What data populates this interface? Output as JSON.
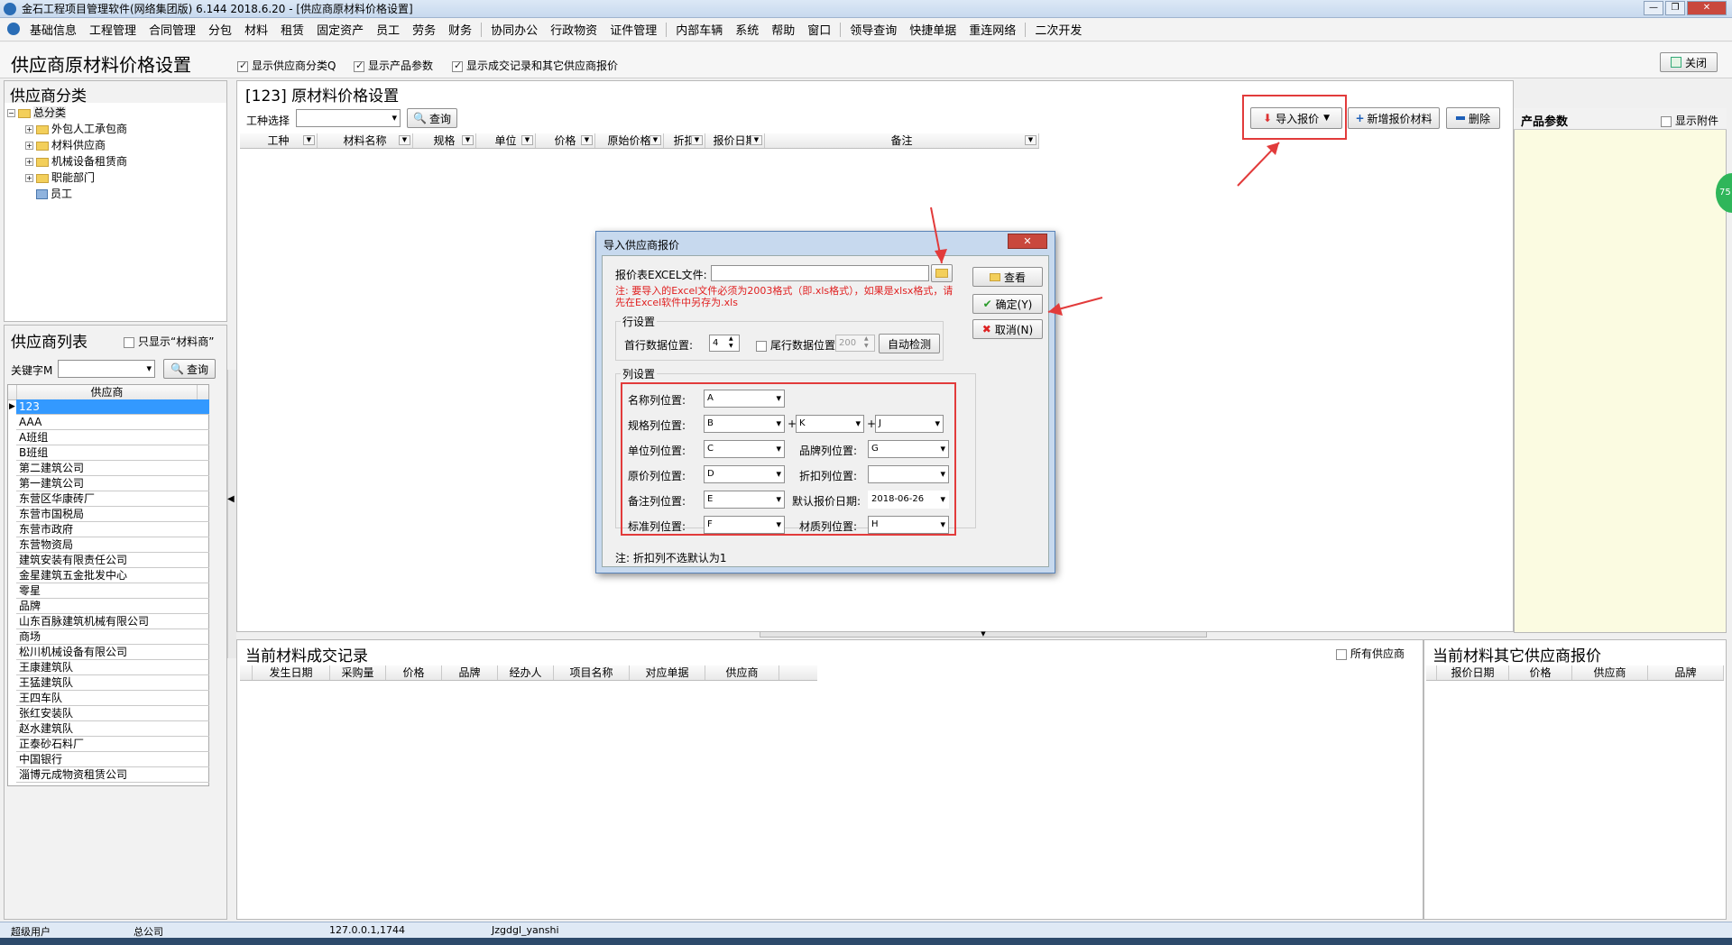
{
  "window": {
    "title": "金石工程项目管理软件(网络集团版) 6.144  2018.6.20 - [供应商原材料价格设置]"
  },
  "menu": [
    "基础信息",
    "工程管理",
    "合同管理",
    "分包",
    "材料",
    "租赁",
    "固定资产",
    "员工",
    "劳务",
    "财务",
    "协同办公",
    "行政物资",
    "证件管理",
    "内部车辆",
    "系统",
    "帮助",
    "窗口",
    "领导查询",
    "快捷单据",
    "重连网络",
    "二次开发"
  ],
  "page": {
    "title": "供应商原材料价格设置",
    "close_label": "关闭",
    "options": [
      {
        "label": "显示供应商分类Q",
        "checked": true
      },
      {
        "label": "显示产品参数",
        "checked": true
      },
      {
        "label": "显示成交记录和其它供应商报价",
        "checked": true
      }
    ]
  },
  "category_panel": {
    "title": "供应商分类",
    "tree": [
      {
        "label": "总分类",
        "level": 0
      },
      {
        "label": "外包人工承包商",
        "level": 1
      },
      {
        "label": "材料供应商",
        "level": 1
      },
      {
        "label": "机械设备租赁商",
        "level": 1
      },
      {
        "label": "职能部门",
        "level": 1
      },
      {
        "label": "员工",
        "level": 1
      }
    ]
  },
  "supplier_panel": {
    "title": "供应商列表",
    "only_material_label": "只显示“材料商”",
    "keyword_label": "关键字M",
    "query_label": "查询",
    "column": "供应商",
    "rows": [
      "123",
      "AAA",
      "A班组",
      "B班组",
      "第二建筑公司",
      "第一建筑公司",
      "东营区华康砖厂",
      "东营市国税局",
      "东营市政府",
      "东营物资局",
      "建筑安装有限责任公司",
      "金星建筑五金批发中心",
      "零星",
      "品牌",
      "山东百脉建筑机械有限公司",
      "商场",
      "松川机械设备有限公司",
      "王康建筑队",
      "王猛建筑队",
      "王四车队",
      "张红安装队",
      "赵水建筑队",
      "正泰砂石料厂",
      "中国银行",
      "淄博元成物资租赁公司"
    ]
  },
  "main_panel": {
    "title": "[123] 原材料价格设置",
    "trade_label": "工种选择",
    "query_label": "查询",
    "import_label": "导入报价",
    "add_label": "新增报价材料",
    "delete_label": "删除",
    "columns": [
      "工种",
      "材料名称",
      "规格",
      "单位",
      "价格",
      "原始价格",
      "折扣",
      "报价日期",
      "备注"
    ]
  },
  "params_panel": {
    "title": "产品参数",
    "attach_label": "显示附件",
    "badge": "75"
  },
  "records_panel": {
    "title": "当前材料成交记录",
    "all_suppliers_label": "所有供应商",
    "columns": [
      "发生日期",
      "采购量",
      "价格",
      "品牌",
      "经办人",
      "项目名称",
      "对应单据",
      "供应商"
    ]
  },
  "other_panel": {
    "title": "当前材料其它供应商报价",
    "columns": [
      "报价日期",
      "价格",
      "供应商",
      "品牌"
    ]
  },
  "dialog": {
    "title": "导入供应商报价",
    "file_label": "报价表EXCEL文件:",
    "note": "注: 要导入的Excel文件必须为2003格式（即.xls格式），如果是xlsx格式，请先在Excel软件中另存为.xls",
    "view_label": "查看",
    "ok_label": "确定(Y)",
    "cancel_label": "取消(N)",
    "row_group": "行设置",
    "first_row_label": "首行数据位置:",
    "first_row_value": "4",
    "last_row_label": "尾行数据位置",
    "last_row_value": "200",
    "auto_detect_label": "自动检测",
    "col_group": "列设置",
    "name_label": "名称列位置:",
    "name_val": "A",
    "spec_label": "规格列位置:",
    "spec_val": "B",
    "spec_val2": "K",
    "spec_val3": "J",
    "plus": "+",
    "unit_label": "单位列位置:",
    "unit_val": "C",
    "brand_label": "品牌列位置:",
    "brand_val": "G",
    "price_label": "原价列位置:",
    "price_val": "D",
    "discount_label": "折扣列位置:",
    "discount_val": "",
    "remark_label": "备注列位置:",
    "remark_val": "E",
    "date_label": "默认报价日期:",
    "date_val": "2018-06-26",
    "standard_label": "标准列位置:",
    "standard_val": "F",
    "material_label": "材质列位置:",
    "material_val": "H",
    "footer_note": "注: 折扣列不选默认为1"
  },
  "status": {
    "user": "超级用户",
    "company": "总公司",
    "ip": "127.0.0.1,1744",
    "db": "Jzgdgl_yanshi"
  }
}
